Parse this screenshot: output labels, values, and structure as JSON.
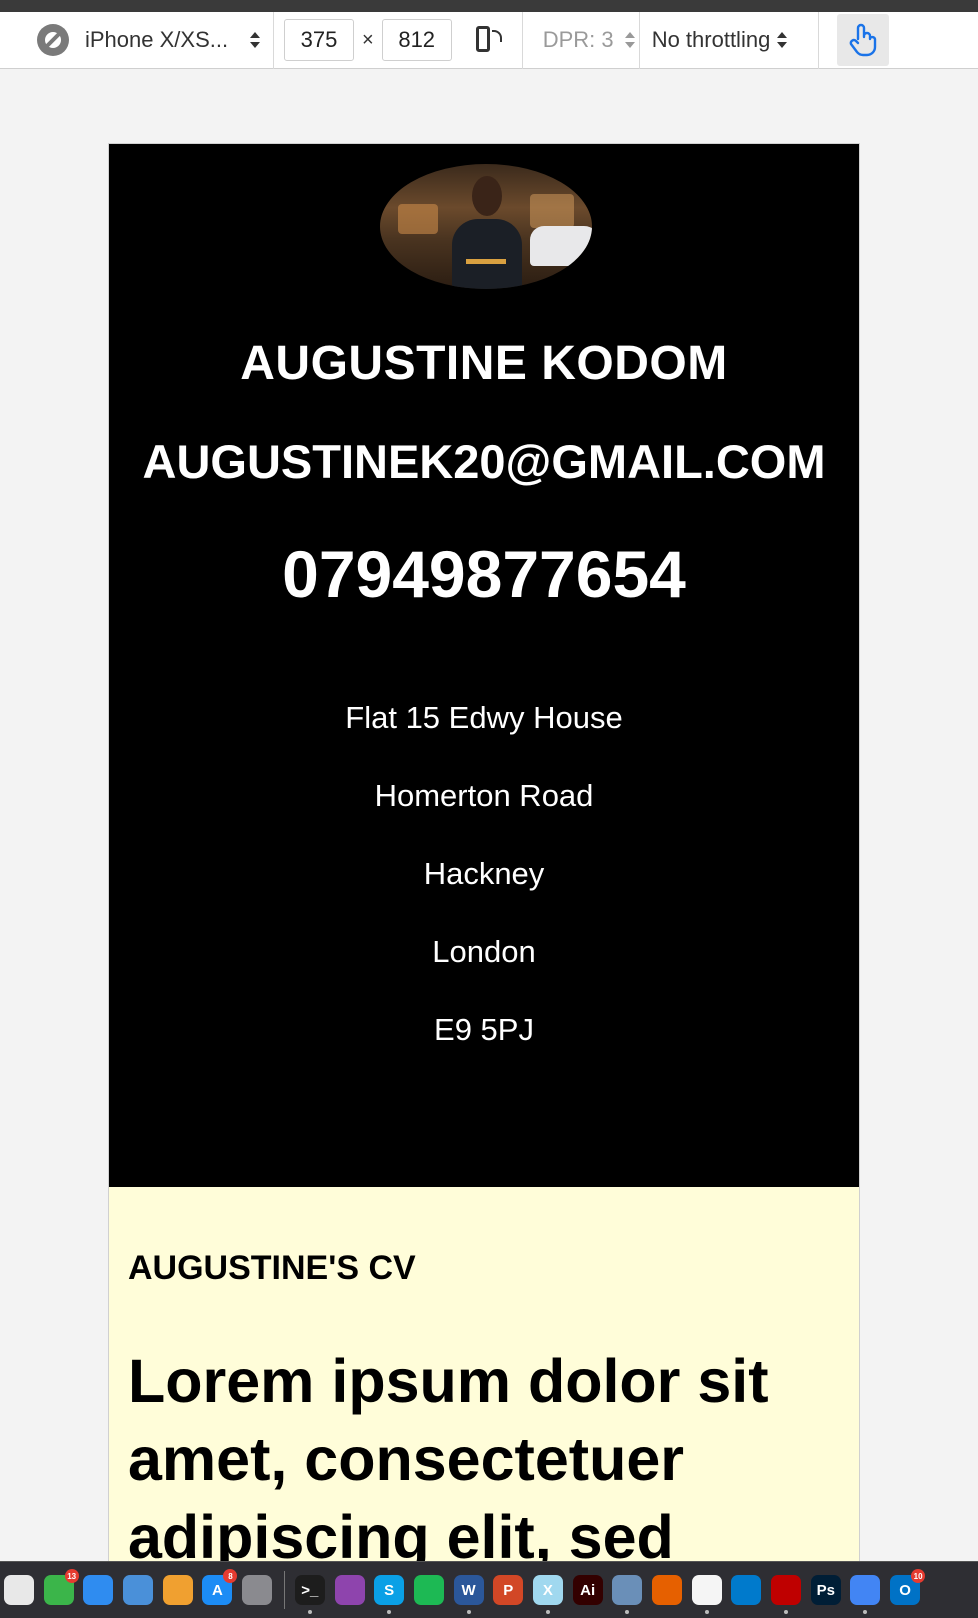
{
  "devtools": {
    "device_name": "iPhone X/XS...",
    "width_value": "375",
    "times_symbol": "×",
    "height_value": "812",
    "dpr_label": "DPR: 3",
    "throttling_label": "No throttling"
  },
  "page": {
    "name": "AUGUSTINE KODOM",
    "email": "AUGUSTINEK20@GMAIL.COM",
    "phone": "07949877654",
    "address": [
      "Flat 15 Edwy House",
      "Homerton Road",
      "Hackney",
      "London",
      "E9 5PJ"
    ],
    "cv_label": "AUGUSTINE'S CV",
    "lorem_heading": "Lorem ipsum dolor sit amet, consectetuer adipiscing elit, sed"
  },
  "colors": {
    "hero_bg": "#000000",
    "cv_bg": "#fffdd9",
    "page_bg": "#f3f3f3"
  },
  "dock": {
    "icons": [
      {
        "name": "news-icon",
        "color": "#e8e8e8",
        "text": "",
        "badge": ""
      },
      {
        "name": "facetime-icon",
        "color": "#3bb54a",
        "text": "",
        "badge": "13"
      },
      {
        "name": "numbers-icon",
        "color": "#2f8cf0",
        "text": "",
        "badge": ""
      },
      {
        "name": "keynote-icon",
        "color": "#4a90d9",
        "text": "",
        "badge": ""
      },
      {
        "name": "pages-icon",
        "color": "#f0a030",
        "text": "",
        "badge": ""
      },
      {
        "name": "app-store-icon",
        "color": "#1c8cf5",
        "text": "A",
        "badge": "8"
      },
      {
        "name": "system-preferences-icon",
        "color": "#8a8a8f",
        "text": "",
        "badge": ""
      },
      {
        "name": "terminal-icon",
        "color": "#1d1d1d",
        "text": ">_",
        "badge": ""
      },
      {
        "name": "podcasts-icon",
        "color": "#8e44ad",
        "text": "",
        "badge": ""
      },
      {
        "name": "skype-icon",
        "color": "#0aa0e6",
        "text": "S",
        "badge": ""
      },
      {
        "name": "spotify-icon",
        "color": "#1db954",
        "text": "",
        "badge": ""
      },
      {
        "name": "word-icon",
        "color": "#2b579a",
        "text": "W",
        "badge": ""
      },
      {
        "name": "powerpoint-icon",
        "color": "#d24726",
        "text": "P",
        "badge": ""
      },
      {
        "name": "xcode-icon",
        "color": "#a0d8ef",
        "text": "X",
        "badge": ""
      },
      {
        "name": "illustrator-icon",
        "color": "#330000",
        "text": "Ai",
        "badge": ""
      },
      {
        "name": "preview-icon",
        "color": "#6a8fb8",
        "text": "",
        "badge": ""
      },
      {
        "name": "firefox-icon",
        "color": "#e66000",
        "text": "",
        "badge": ""
      },
      {
        "name": "textedit-icon",
        "color": "#f5f5f5",
        "text": "",
        "badge": ""
      },
      {
        "name": "vscode-icon",
        "color": "#007acc",
        "text": "",
        "badge": ""
      },
      {
        "name": "filezilla-icon",
        "color": "#bf0000",
        "text": "",
        "badge": ""
      },
      {
        "name": "photoshop-icon",
        "color": "#001e36",
        "text": "Ps",
        "badge": ""
      },
      {
        "name": "chrome-icon",
        "color": "#4285f4",
        "text": "",
        "badge": ""
      },
      {
        "name": "outlook-icon",
        "color": "#0072c6",
        "text": "O",
        "badge": "10"
      }
    ]
  }
}
